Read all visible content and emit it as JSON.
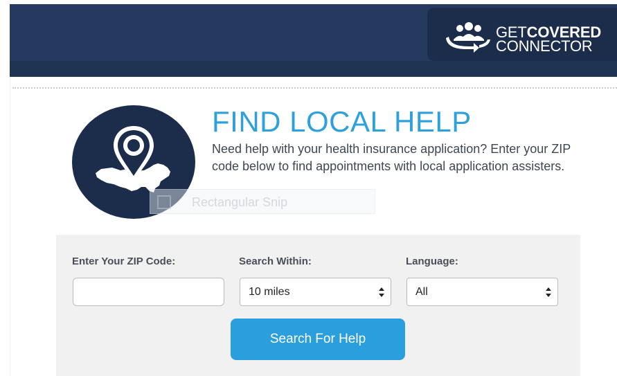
{
  "header": {
    "logo_icon": "people-arrow-icon",
    "logo_text_line1_regular": "GET",
    "logo_text_line1_bold": "COVERED",
    "logo_text_line2": "CONNECTOR",
    "background_color": "#253a5e"
  },
  "hero": {
    "icon": "location-pin-map-icon",
    "title": "FIND LOCAL HELP",
    "description": "Need help with your health insurance application? Enter your ZIP code below to find appointments with local application assisters.",
    "title_color": "#2ea0dc"
  },
  "overlay": {
    "snip_label": "Rectangular Snip"
  },
  "search": {
    "zip_label": "Enter Your ZIP Code:",
    "zip_value": "",
    "zip_placeholder": "",
    "within_label": "Search Within:",
    "within_selected": "10 miles",
    "language_label": "Language:",
    "language_selected": "All",
    "button_label": "Search For Help",
    "button_color": "#2b9fde"
  }
}
